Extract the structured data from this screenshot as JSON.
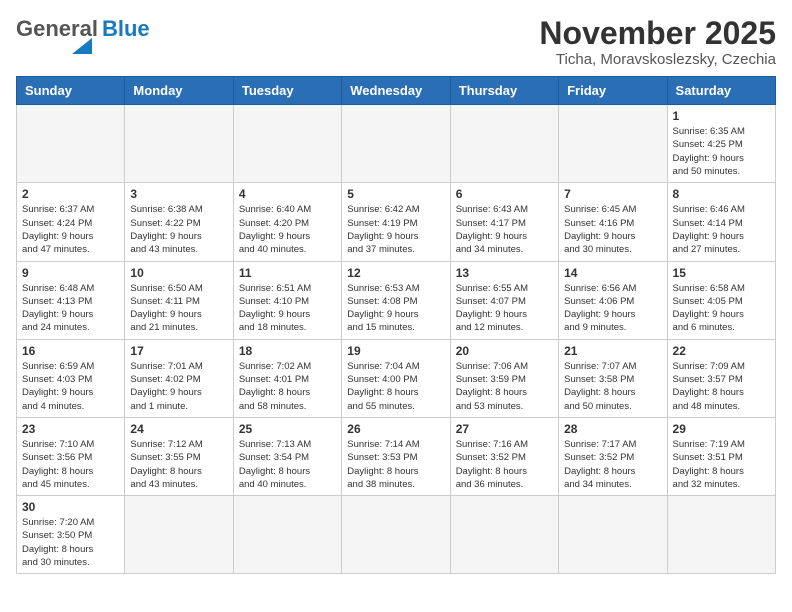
{
  "header": {
    "logo_general": "General",
    "logo_blue": "Blue",
    "title": "November 2025",
    "subtitle": "Ticha, Moravskoslezsky, Czechia"
  },
  "days_of_week": [
    "Sunday",
    "Monday",
    "Tuesday",
    "Wednesday",
    "Thursday",
    "Friday",
    "Saturday"
  ],
  "weeks": [
    [
      {
        "day": "",
        "info": ""
      },
      {
        "day": "",
        "info": ""
      },
      {
        "day": "",
        "info": ""
      },
      {
        "day": "",
        "info": ""
      },
      {
        "day": "",
        "info": ""
      },
      {
        "day": "",
        "info": ""
      },
      {
        "day": "1",
        "info": "Sunrise: 6:35 AM\nSunset: 4:25 PM\nDaylight: 9 hours\nand 50 minutes."
      }
    ],
    [
      {
        "day": "2",
        "info": "Sunrise: 6:37 AM\nSunset: 4:24 PM\nDaylight: 9 hours\nand 47 minutes."
      },
      {
        "day": "3",
        "info": "Sunrise: 6:38 AM\nSunset: 4:22 PM\nDaylight: 9 hours\nand 43 minutes."
      },
      {
        "day": "4",
        "info": "Sunrise: 6:40 AM\nSunset: 4:20 PM\nDaylight: 9 hours\nand 40 minutes."
      },
      {
        "day": "5",
        "info": "Sunrise: 6:42 AM\nSunset: 4:19 PM\nDaylight: 9 hours\nand 37 minutes."
      },
      {
        "day": "6",
        "info": "Sunrise: 6:43 AM\nSunset: 4:17 PM\nDaylight: 9 hours\nand 34 minutes."
      },
      {
        "day": "7",
        "info": "Sunrise: 6:45 AM\nSunset: 4:16 PM\nDaylight: 9 hours\nand 30 minutes."
      },
      {
        "day": "8",
        "info": "Sunrise: 6:46 AM\nSunset: 4:14 PM\nDaylight: 9 hours\nand 27 minutes."
      }
    ],
    [
      {
        "day": "9",
        "info": "Sunrise: 6:48 AM\nSunset: 4:13 PM\nDaylight: 9 hours\nand 24 minutes."
      },
      {
        "day": "10",
        "info": "Sunrise: 6:50 AM\nSunset: 4:11 PM\nDaylight: 9 hours\nand 21 minutes."
      },
      {
        "day": "11",
        "info": "Sunrise: 6:51 AM\nSunset: 4:10 PM\nDaylight: 9 hours\nand 18 minutes."
      },
      {
        "day": "12",
        "info": "Sunrise: 6:53 AM\nSunset: 4:08 PM\nDaylight: 9 hours\nand 15 minutes."
      },
      {
        "day": "13",
        "info": "Sunrise: 6:55 AM\nSunset: 4:07 PM\nDaylight: 9 hours\nand 12 minutes."
      },
      {
        "day": "14",
        "info": "Sunrise: 6:56 AM\nSunset: 4:06 PM\nDaylight: 9 hours\nand 9 minutes."
      },
      {
        "day": "15",
        "info": "Sunrise: 6:58 AM\nSunset: 4:05 PM\nDaylight: 9 hours\nand 6 minutes."
      }
    ],
    [
      {
        "day": "16",
        "info": "Sunrise: 6:59 AM\nSunset: 4:03 PM\nDaylight: 9 hours\nand 4 minutes."
      },
      {
        "day": "17",
        "info": "Sunrise: 7:01 AM\nSunset: 4:02 PM\nDaylight: 9 hours\nand 1 minute."
      },
      {
        "day": "18",
        "info": "Sunrise: 7:02 AM\nSunset: 4:01 PM\nDaylight: 8 hours\nand 58 minutes."
      },
      {
        "day": "19",
        "info": "Sunrise: 7:04 AM\nSunset: 4:00 PM\nDaylight: 8 hours\nand 55 minutes."
      },
      {
        "day": "20",
        "info": "Sunrise: 7:06 AM\nSunset: 3:59 PM\nDaylight: 8 hours\nand 53 minutes."
      },
      {
        "day": "21",
        "info": "Sunrise: 7:07 AM\nSunset: 3:58 PM\nDaylight: 8 hours\nand 50 minutes."
      },
      {
        "day": "22",
        "info": "Sunrise: 7:09 AM\nSunset: 3:57 PM\nDaylight: 8 hours\nand 48 minutes."
      }
    ],
    [
      {
        "day": "23",
        "info": "Sunrise: 7:10 AM\nSunset: 3:56 PM\nDaylight: 8 hours\nand 45 minutes."
      },
      {
        "day": "24",
        "info": "Sunrise: 7:12 AM\nSunset: 3:55 PM\nDaylight: 8 hours\nand 43 minutes."
      },
      {
        "day": "25",
        "info": "Sunrise: 7:13 AM\nSunset: 3:54 PM\nDaylight: 8 hours\nand 40 minutes."
      },
      {
        "day": "26",
        "info": "Sunrise: 7:14 AM\nSunset: 3:53 PM\nDaylight: 8 hours\nand 38 minutes."
      },
      {
        "day": "27",
        "info": "Sunrise: 7:16 AM\nSunset: 3:52 PM\nDaylight: 8 hours\nand 36 minutes."
      },
      {
        "day": "28",
        "info": "Sunrise: 7:17 AM\nSunset: 3:52 PM\nDaylight: 8 hours\nand 34 minutes."
      },
      {
        "day": "29",
        "info": "Sunrise: 7:19 AM\nSunset: 3:51 PM\nDaylight: 8 hours\nand 32 minutes."
      }
    ],
    [
      {
        "day": "30",
        "info": "Sunrise: 7:20 AM\nSunset: 3:50 PM\nDaylight: 8 hours\nand 30 minutes."
      },
      {
        "day": "",
        "info": ""
      },
      {
        "day": "",
        "info": ""
      },
      {
        "day": "",
        "info": ""
      },
      {
        "day": "",
        "info": ""
      },
      {
        "day": "",
        "info": ""
      },
      {
        "day": "",
        "info": ""
      }
    ]
  ]
}
